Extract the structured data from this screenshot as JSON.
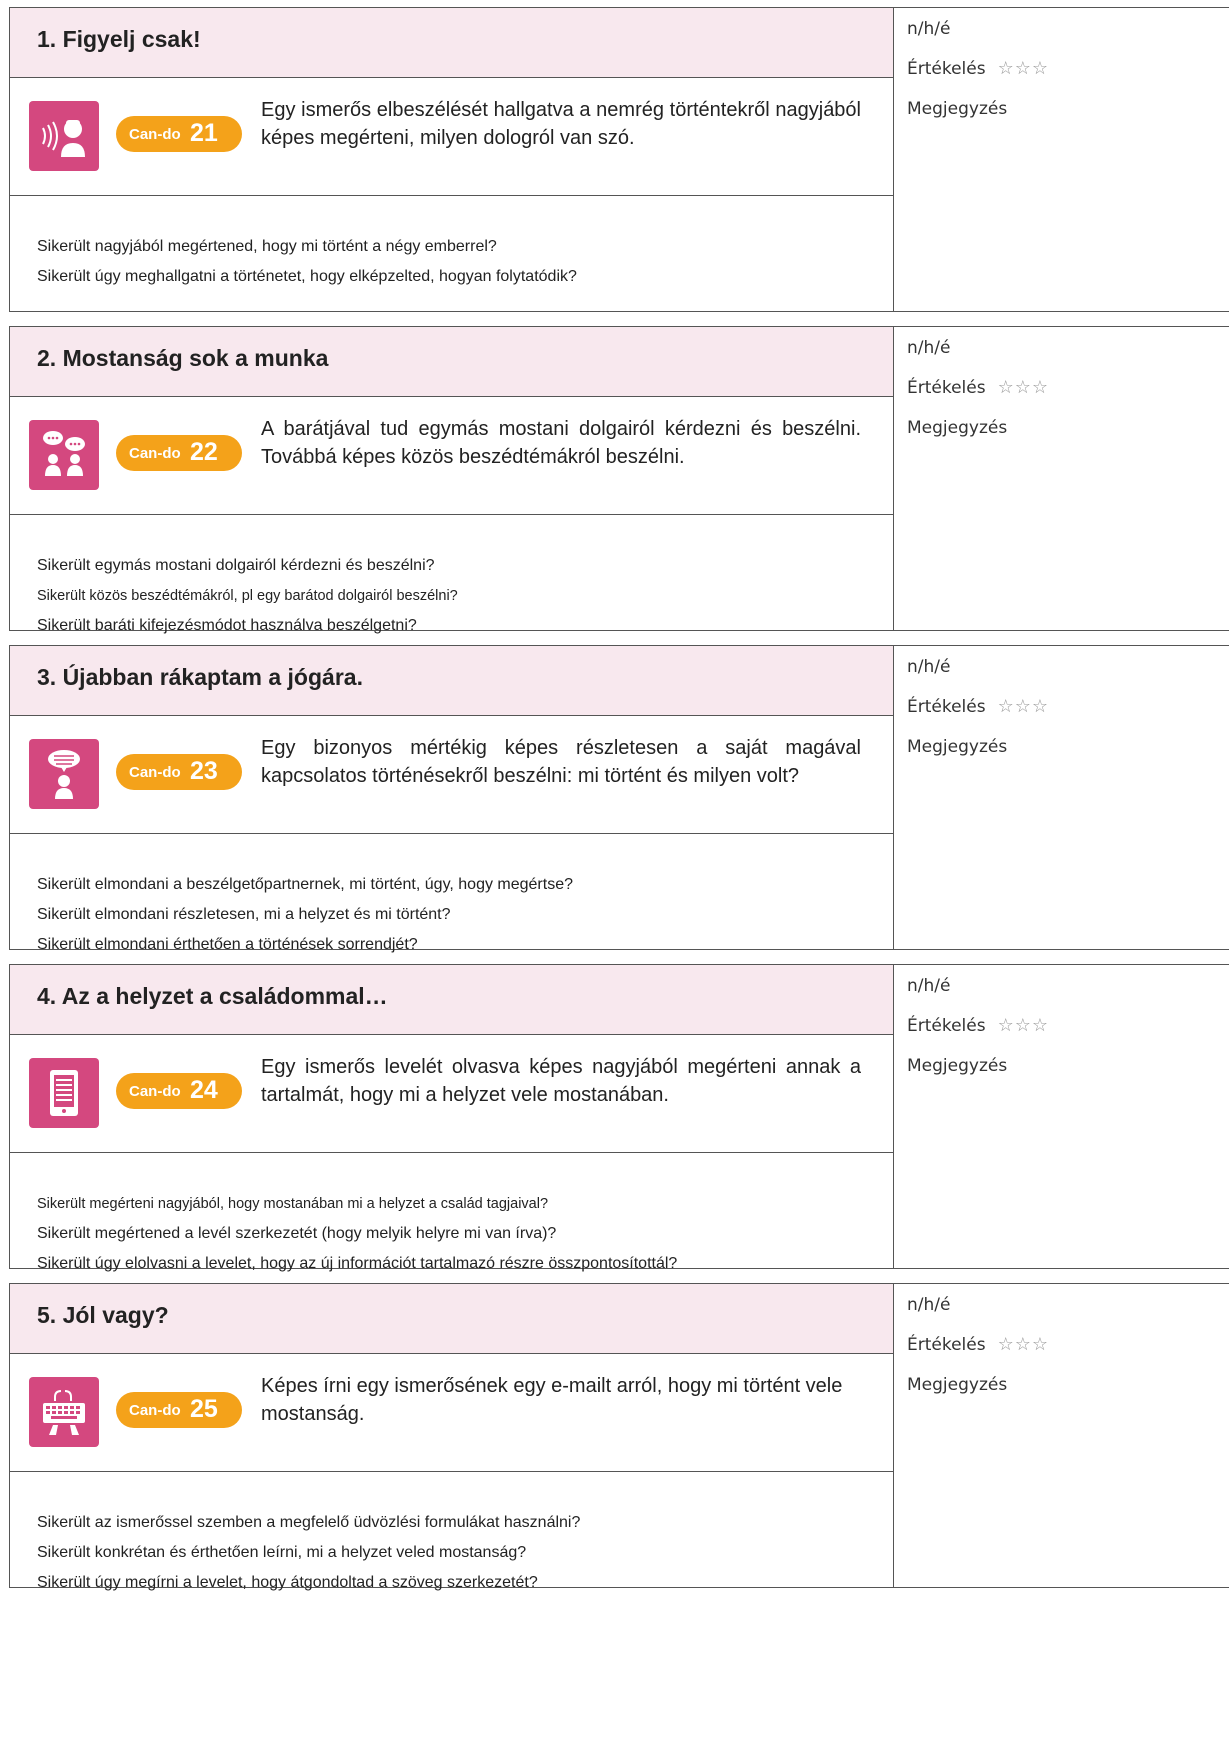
{
  "labels": {
    "nhe": "n/h/é",
    "evaluation": "Értékelés",
    "stars": "☆☆☆",
    "note": "Megjegyzés",
    "cando_prefix": "Can-do"
  },
  "sections": [
    {
      "title": "1. Figyelj csak!",
      "icon": "listening-icon",
      "cando_number": "21",
      "cando_text": "Egy ismerős elbeszélését hallgatva a nemrég történtekről nagyjából képes megérteni, milyen dologról van szó.",
      "questions": [
        "Sikerült nagyjából megértened, hogy mi történt a négy emberrel?",
        "Sikerült úgy meghallgatni a történetet, hogy elképzelted, hogyan folytatódik?"
      ]
    },
    {
      "title": "2. Mostanság sok a munka",
      "icon": "conversation-icon",
      "cando_number": "22",
      "cando_text": "A barátjával tud egymás mostani dolgairól kérdezni és beszélni. Továbbá képes közös beszédtémákról beszélni.",
      "questions": [
        "Sikerült egymás mostani dolgairól kérdezni és beszélni?",
        "Sikerült közös beszédtémákról, pl egy barátod dolgairól beszélni?",
        "Sikerült baráti kifejezésmódot használva beszélgetni?"
      ]
    },
    {
      "title": "3. Újabban rákaptam a jógára.",
      "icon": "speaking-icon",
      "cando_number": "23",
      "cando_text": "Egy bizonyos mértékig képes részletesen a saját magával kapcsolatos történésekről beszélni: mi történt és milyen volt?",
      "questions": [
        "Sikerült elmondani a beszélgetőpartnernek, mi történt, úgy, hogy megértse?",
        "Sikerült elmondani részletesen, mi a helyzet és mi történt?",
        "Sikerült elmondani érthetően a történések sorrendjét?"
      ]
    },
    {
      "title": "4. Az a helyzet a családommal…",
      "icon": "reading-icon",
      "cando_number": "24",
      "cando_text": "Egy ismerős levelét olvasva képes nagyjából megérteni annak a tartalmát, hogy mi a helyzet vele mostanában.",
      "questions": [
        "Sikerült megérteni nagyjából, hogy mostanában mi a helyzet a család tagjaival?",
        "Sikerült megértened a levél szerkezetét (hogy melyik helyre mi van írva)?",
        "Sikerült úgy elolvasni a levelet, hogy az új információt tartalmazó részre összpontosítottál?"
      ]
    },
    {
      "title": "5. Jól vagy?",
      "icon": "writing-icon",
      "cando_number": "25",
      "cando_text": "Képes írni egy ismerősének egy e-mailt arról, hogy mi történt vele mostanság.",
      "questions": [
        "Sikerült az ismerőssel szemben a megfelelő üdvözlési formulákat használni?",
        "Sikerült konkrétan és érthetően leírni, mi a helyzet veled mostanság?",
        "Sikerült úgy megírni a levelet, hogy átgondoltad a szöveg szerkezetét?"
      ]
    }
  ]
}
